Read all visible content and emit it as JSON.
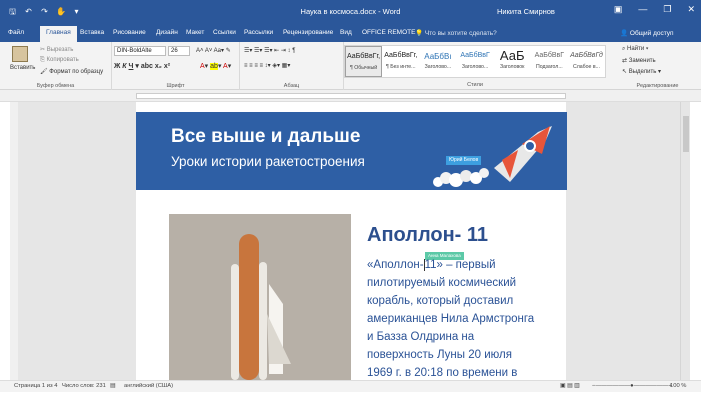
{
  "titlebar": {
    "document_title": "Наука в космоса.docx - Word",
    "user": "Никита Смирнов"
  },
  "tabs": [
    {
      "label": "Файл"
    },
    {
      "label": "Главная"
    },
    {
      "label": "Вставка"
    },
    {
      "label": "Рисование"
    },
    {
      "label": "Дизайн"
    },
    {
      "label": "Макет"
    },
    {
      "label": "Ссылки"
    },
    {
      "label": "Рассылки"
    },
    {
      "label": "Рецензирование"
    },
    {
      "label": "Вид"
    },
    {
      "label": "OFFICE REMOTE"
    }
  ],
  "tellme": "Что вы хотите сделать?",
  "share": "Общий доступ",
  "clipboard": {
    "paste": "Вставить",
    "cut": "Вырезать",
    "copy": "Копировать",
    "format_painter": "Формат по образцу",
    "group": "Буфер обмена"
  },
  "font": {
    "name": "DIN-BoldAlte",
    "size": "26",
    "group": "Шрифт"
  },
  "paragraph": {
    "group": "Абзац"
  },
  "styles": {
    "group": "Стили",
    "items": [
      {
        "sample": "АаБбВвГг,",
        "name": "¶ Обычный"
      },
      {
        "sample": "АаБбВвГг,",
        "name": "¶ Без инте..."
      },
      {
        "sample": "АаБбВı",
        "name": "Заголово..."
      },
      {
        "sample": "АаБбВвГ",
        "name": "Заголово..."
      },
      {
        "sample": "АаБ",
        "name": "Заголовок"
      },
      {
        "sample": "АаБбВвГ",
        "name": "Подзагол..."
      },
      {
        "sample": "АаБбВвГд",
        "name": "Слабое в..."
      }
    ]
  },
  "editing": {
    "find": "Найти",
    "replace": "Заменить",
    "select": "Выделить",
    "group": "Редактирование"
  },
  "document": {
    "banner_title": "Все выше и дальше",
    "banner_subtitle": "Уроки истории ракетостроения",
    "collab_user": "Юрий Белов",
    "heading": "Аполлон- 11",
    "body_before": "«Аполлон-",
    "body_cursor_char": "1",
    "body_after": "1» – первый пилотируемый космический корабль, который доставил американцев Нила Армстронга и Базза Олдрина на поверхность Луны 20 июля 1969 г.  в 20:18 по времени в",
    "collab_user2": "Анна Малахова"
  },
  "status": {
    "page": "Страница 1 из 4",
    "words": "Число слов: 231",
    "language": "английский (США)",
    "zoom": "100 %"
  },
  "colors": {
    "accent": "#2b579a",
    "banner": "#2e5fa5",
    "heading": "#2c4f8e"
  }
}
